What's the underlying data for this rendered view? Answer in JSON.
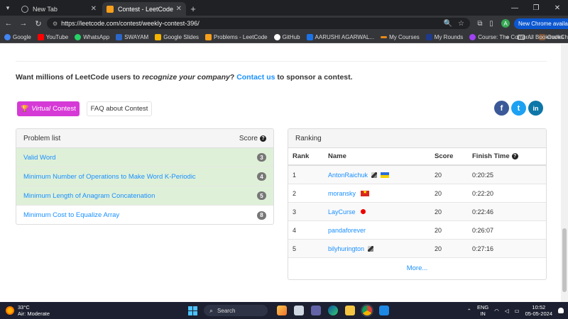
{
  "browser": {
    "tabs": [
      {
        "title": "New Tab",
        "active": false
      },
      {
        "title": "Contest - LeetCode",
        "active": true
      }
    ],
    "url": "https://leetcode.com/contest/weekly-contest-396/",
    "new_chrome_label": "New Chrome available",
    "avatar_letter": "A",
    "bookmarks": [
      {
        "label": "Google",
        "color": "#4285f4"
      },
      {
        "label": "YouTube",
        "color": "#ff0000"
      },
      {
        "label": "WhatsApp",
        "color": "#25d366"
      },
      {
        "label": "SWAYAM",
        "color": "#2b66c9"
      },
      {
        "label": "Google Slides",
        "color": "#f4b400"
      },
      {
        "label": "Problems - LeetCode",
        "color": "#f89f1b"
      },
      {
        "label": "GitHub",
        "color": "#ffffff"
      },
      {
        "label": "AARUSHI AGARWAL...",
        "color": "#1a73e8"
      },
      {
        "label": "My Courses",
        "color": "#e88a1a"
      },
      {
        "label": "My Rounds",
        "color": "#1e3a8a"
      },
      {
        "label": "Course: The Compr...",
        "color": "#a142f4"
      },
      {
        "label": "CodeChef",
        "color": "#7b5236"
      }
    ],
    "all_bookmarks_label": "All Bookmarks"
  },
  "sponsor": {
    "prefix": "Want millions of LeetCode users to ",
    "emph": "recognize your company",
    "middle": "? ",
    "link": "Contact us",
    "suffix": " to sponsor a contest."
  },
  "buttons": {
    "virtual_emph": "Virtual",
    "virtual_rest": "Contest",
    "faq": "FAQ about Contest"
  },
  "social": {
    "facebook": "f",
    "twitter": "t",
    "linkedin": "in"
  },
  "problem_list": {
    "title": "Problem list",
    "score_label": "Score",
    "problems": [
      {
        "name": "Valid Word",
        "score": "3",
        "solved": true
      },
      {
        "name": "Minimum Number of Operations to Make Word K-Periodic",
        "score": "4",
        "solved": true
      },
      {
        "name": "Minimum Length of Anagram Concatenation",
        "score": "5",
        "solved": true
      },
      {
        "name": "Minimum Cost to Equalize Array",
        "score": "8",
        "solved": false
      }
    ]
  },
  "ranking": {
    "title": "Ranking",
    "headers": {
      "rank": "Rank",
      "name": "Name",
      "score": "Score",
      "finish": "Finish Time"
    },
    "rows": [
      {
        "rank": "1",
        "name": "AntonRaichuk",
        "score": "20",
        "time": "0:20:25"
      },
      {
        "rank": "2",
        "name": "moransky",
        "score": "20",
        "time": "0:22:20"
      },
      {
        "rank": "3",
        "name": "LayCurse",
        "score": "20",
        "time": "0:22:46"
      },
      {
        "rank": "4",
        "name": "pandaforever",
        "score": "20",
        "time": "0:26:07"
      },
      {
        "rank": "5",
        "name": "bilyhurington",
        "score": "20",
        "time": "0:27:16"
      }
    ],
    "more": "More..."
  },
  "taskbar": {
    "temperature": "33°C",
    "weather": "Air: Moderate",
    "search": "Search",
    "lang_top": "ENG",
    "lang_bottom": "IN",
    "time": "10:52",
    "date": "05-05-2024"
  }
}
